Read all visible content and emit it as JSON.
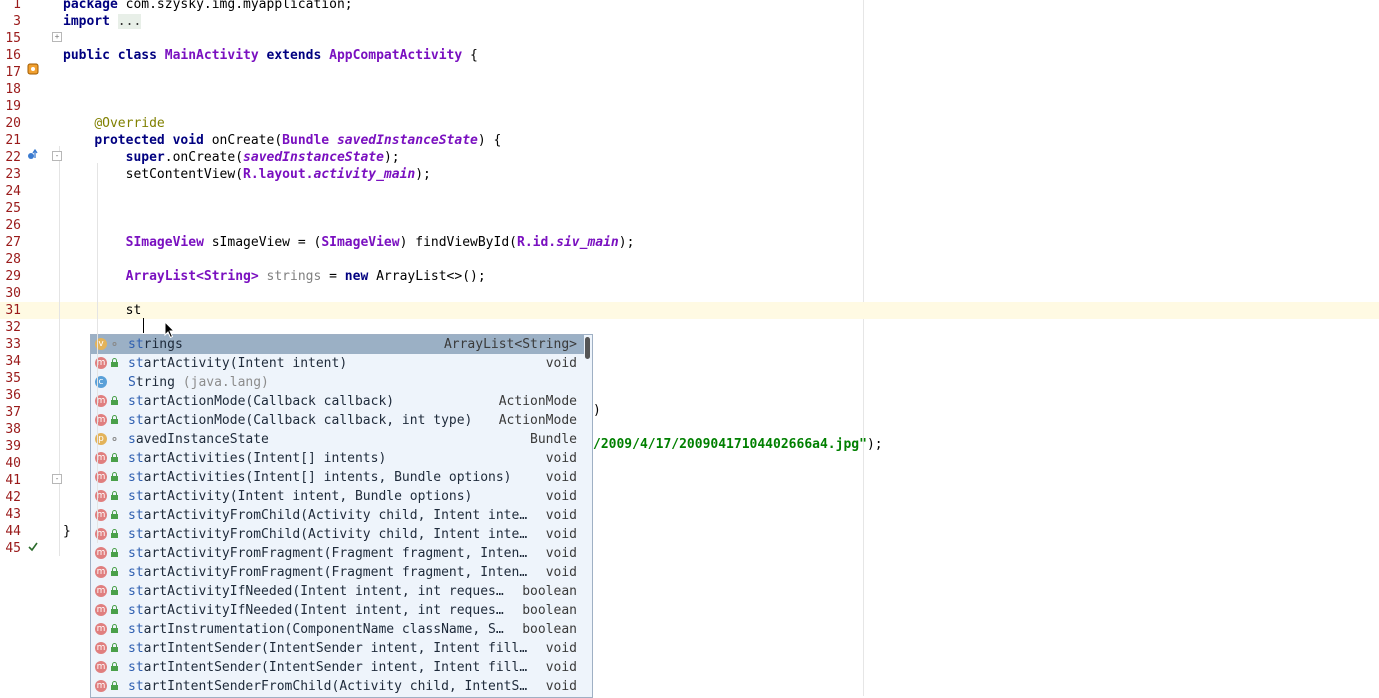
{
  "editor": {
    "lines": [
      {
        "n": "1"
      },
      {
        "n": "3"
      },
      {
        "n": "15"
      },
      {
        "n": "16"
      },
      {
        "n": "17"
      },
      {
        "n": "18"
      },
      {
        "n": "19"
      },
      {
        "n": "20"
      },
      {
        "n": "21"
      },
      {
        "n": "22"
      },
      {
        "n": "23"
      },
      {
        "n": "24"
      },
      {
        "n": "25"
      },
      {
        "n": "26"
      },
      {
        "n": "27"
      },
      {
        "n": "28"
      },
      {
        "n": "29"
      },
      {
        "n": "30"
      },
      {
        "n": "31"
      },
      {
        "n": "32"
      },
      {
        "n": "33"
      },
      {
        "n": "34"
      },
      {
        "n": "35"
      },
      {
        "n": "36"
      },
      {
        "n": "37"
      },
      {
        "n": "38"
      },
      {
        "n": "39"
      },
      {
        "n": "40"
      },
      {
        "n": "41"
      },
      {
        "n": "42"
      },
      {
        "n": "43"
      },
      {
        "n": "44"
      },
      {
        "n": "45"
      }
    ],
    "code": {
      "l1_kw": "package",
      "l1_rest": " com.szysky.img.myapplication;",
      "l3_kw": "import",
      "l3_fold": "...",
      "l16_kw": "public class",
      "l16_name": "MainActivity",
      "l16_ext": "extends",
      "l16_super": "AppCompatActivity",
      "l16_end": " {",
      "l20_ann": "@Override",
      "l21_kw": "protected void",
      "l21_m": " onCreate(",
      "l21_type": "Bundle",
      "l21_param": "savedInstanceState",
      "l21_end": ") {",
      "l22_kw": "super",
      "l22_m": ".onCreate(",
      "l22_arg": "savedInstanceState",
      "l22_end": ");",
      "l23_a": "setContentView(",
      "l23_r": "R.layout.",
      "l23_f": "activity_main",
      "l23_end": ");",
      "l27_type": "SImageView",
      "l27_a": " sImageView = (",
      "l27_cast": "SImageView",
      "l27_b": ") findViewById(",
      "l27_r": "R.id.",
      "l27_f": "siv_main",
      "l27_end": ");",
      "l29_type": "ArrayList<String>",
      "l29_var": " strings",
      "l29_a": " = ",
      "l29_new": "new",
      "l29_b": " ArrayList<>();",
      "l31_typed": "st",
      "l36_tail": ")",
      "l38_str": "/2009/4/17/20090417104402666a4.jpg\"",
      "l38_end": ");",
      "l44_brace": "}"
    }
  },
  "completion": {
    "items": [
      {
        "badge": "v",
        "label_hl": "st",
        "label_rest": "rings",
        "pkg": "",
        "type": "ArrayList<String>",
        "selected": true
      },
      {
        "badge": "m",
        "label_hl": "st",
        "label_rest": "artActivity(Intent intent)",
        "pkg": "",
        "type": "void"
      },
      {
        "badge": "c",
        "label_hl": "S",
        "label_rest": "tring",
        "pkg": " (java.lang)",
        "type": ""
      },
      {
        "badge": "m",
        "label_hl": "st",
        "label_rest": "artActionMode(Callback callback)",
        "pkg": "",
        "type": "ActionMode"
      },
      {
        "badge": "m",
        "label_hl": "st",
        "label_rest": "artActionMode(Callback callback, int type)",
        "pkg": "",
        "type": "ActionMode"
      },
      {
        "badge": "p",
        "label_hl": "s",
        "label_rest": "avedInstanceState",
        "pkg": "",
        "type": "Bundle"
      },
      {
        "badge": "m",
        "label_hl": "st",
        "label_rest": "artActivities(Intent[] intents)",
        "pkg": "",
        "type": "void"
      },
      {
        "badge": "m",
        "label_hl": "st",
        "label_rest": "artActivities(Intent[] intents, Bundle options)",
        "pkg": "",
        "type": "void"
      },
      {
        "badge": "m",
        "label_hl": "st",
        "label_rest": "artActivity(Intent intent, Bundle options)",
        "pkg": "",
        "type": "void"
      },
      {
        "badge": "m",
        "label_hl": "st",
        "label_rest": "artActivityFromChild(Activity child, Intent inte…",
        "pkg": "",
        "type": "void"
      },
      {
        "badge": "m",
        "label_hl": "st",
        "label_rest": "artActivityFromChild(Activity child, Intent inte…",
        "pkg": "",
        "type": "void"
      },
      {
        "badge": "m",
        "label_hl": "st",
        "label_rest": "artActivityFromFragment(Fragment fragment, Inten…",
        "pkg": "",
        "type": "void"
      },
      {
        "badge": "m",
        "label_hl": "st",
        "label_rest": "artActivityFromFragment(Fragment fragment, Inten…",
        "pkg": "",
        "type": "void"
      },
      {
        "badge": "m",
        "label_hl": "st",
        "label_rest": "artActivityIfNeeded(Intent intent, int reques…",
        "pkg": "",
        "type": "boolean"
      },
      {
        "badge": "m",
        "label_hl": "st",
        "label_rest": "artActivityIfNeeded(Intent intent, int reques…",
        "pkg": "",
        "type": "boolean"
      },
      {
        "badge": "m",
        "label_hl": "st",
        "label_rest": "artInstrumentation(ComponentName className, S…",
        "pkg": "",
        "type": "boolean"
      },
      {
        "badge": "m",
        "label_hl": "st",
        "label_rest": "artIntentSender(IntentSender intent, Intent fill…",
        "pkg": "",
        "type": "void"
      },
      {
        "badge": "m",
        "label_hl": "st",
        "label_rest": "artIntentSender(IntentSender intent, Intent fill…",
        "pkg": "",
        "type": "void"
      },
      {
        "badge": "m",
        "label_hl": "st",
        "label_rest": "artIntentSenderFromChild(Activity child, IntentS…",
        "pkg": "",
        "type": "void"
      }
    ]
  }
}
